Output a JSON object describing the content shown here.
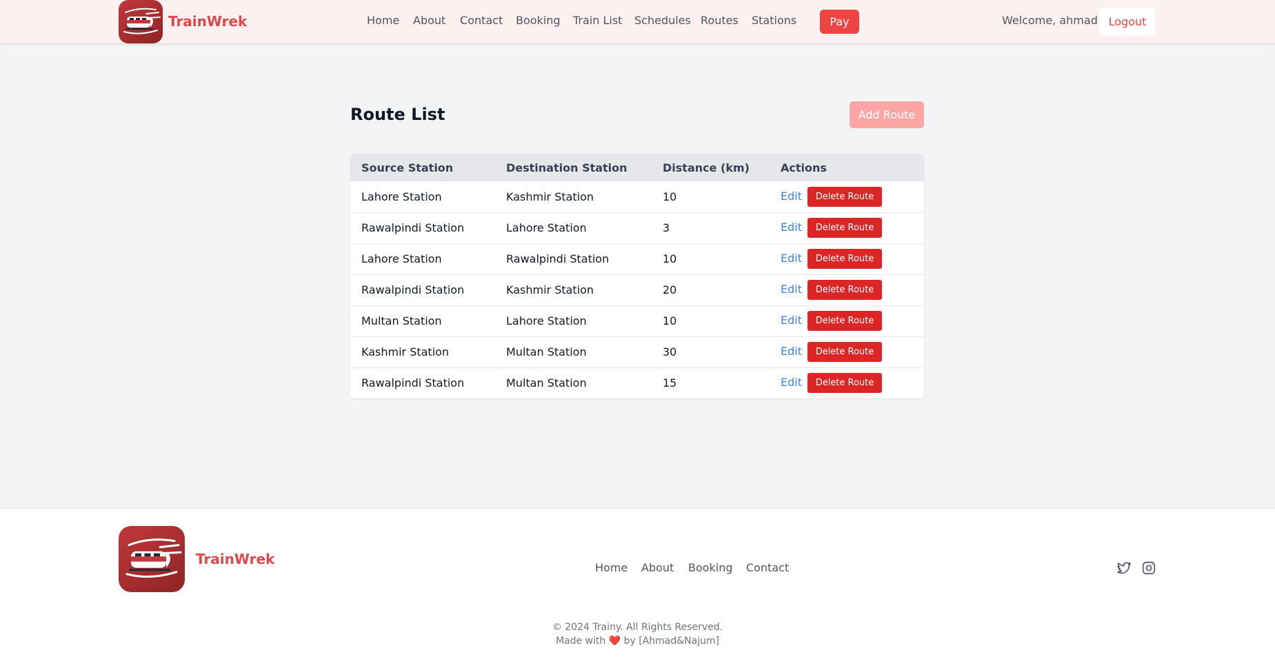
{
  "header": {
    "brand": "TrainWrek",
    "logo_icon": "train-logo-icon",
    "nav": [
      "Home",
      "About",
      "Contact",
      "Booking",
      "Train List",
      "Schedules",
      "Routes",
      "Stations"
    ],
    "pay_label": "Pay",
    "welcome_text": "Welcome, ahmad",
    "logout_label": "Logout"
  },
  "main": {
    "title": "Route List",
    "add_label": "Add Route",
    "table": {
      "headers": [
        "Source Station",
        "Destination Station",
        "Distance (km)",
        "Actions"
      ],
      "edit_label": "Edit",
      "delete_label": "Delete Route",
      "rows": [
        {
          "source": "Lahore Station",
          "destination": "Kashmir Station",
          "distance": "10"
        },
        {
          "source": "Rawalpindi Station",
          "destination": "Lahore Station",
          "distance": "3"
        },
        {
          "source": "Lahore Station",
          "destination": "Rawalpindi Station",
          "distance": "10"
        },
        {
          "source": "Rawalpindi Station",
          "destination": "Kashmir Station",
          "distance": "20"
        },
        {
          "source": "Multan Station",
          "destination": "Lahore Station",
          "distance": "10"
        },
        {
          "source": "Kashmir Station",
          "destination": "Multan Station",
          "distance": "30"
        },
        {
          "source": "Rawalpindi Station",
          "destination": "Multan Station",
          "distance": "15"
        }
      ]
    }
  },
  "footer": {
    "brand": "TrainWrek",
    "nav": [
      "Home",
      "About",
      "Booking",
      "Contact"
    ],
    "social": [
      "twitter-icon",
      "instagram-icon"
    ],
    "copyright": "© 2024 Trainy. All Rights Reserved.",
    "made_with_prefix": "Made with",
    "made_with_suffix": "by [Ahmad&Najum]"
  },
  "colors": {
    "accent": "#ef4444",
    "delete": "#dc2626",
    "link": "#3b82f6",
    "header_bg": "#fdf0f0",
    "page_bg": "#f3f4f6"
  }
}
